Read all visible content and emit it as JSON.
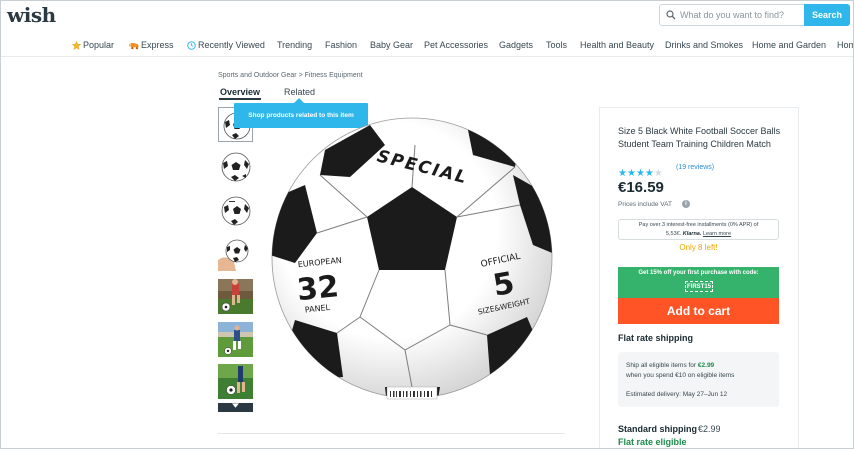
{
  "header": {
    "logo": "wish",
    "search": {
      "placeholder": "What do you want to find?",
      "button": "Search"
    }
  },
  "nav": {
    "items": [
      {
        "label": "Popular",
        "icon": "star-icon"
      },
      {
        "label": "Express",
        "icon": "express-truck-icon"
      },
      {
        "label": "Recently Viewed",
        "icon": "clock-icon"
      },
      {
        "label": "Trending"
      },
      {
        "label": "Fashion"
      },
      {
        "label": "Baby Gear"
      },
      {
        "label": "Pet Accessories"
      },
      {
        "label": "Gadgets"
      },
      {
        "label": "Tools"
      },
      {
        "label": "Health and Beauty"
      },
      {
        "label": "Drinks and Smokes"
      },
      {
        "label": "Home and Garden"
      },
      {
        "label": "Hom"
      }
    ]
  },
  "breadcrumb": {
    "category": "Sports and Outdoor Gear",
    "separator": ">",
    "subcategory": "Fitness Equipment"
  },
  "tabs": {
    "overview": "Overview",
    "related": "Related"
  },
  "tooltip": "Shop products related to this item",
  "product": {
    "title": "Size 5 Black White Football Soccer Balls Student Team Training Children Match",
    "rating": 4,
    "rating_max": 5,
    "reviews": "(19 reviews)",
    "price": "€16.59",
    "vat_note": "Prices include VAT",
    "klarna": {
      "line1": "Pay over 3 interest-free installments (0% APR) of",
      "line2_amount": "5,53€.",
      "brand": "Klarna.",
      "learn_more": "Learn more"
    },
    "stock": "Only 8 left!",
    "promo": {
      "text": "Get 15% off your first purchase with code:",
      "code": "FIRST15"
    },
    "add_to_cart": "Add to cart",
    "ball_print": {
      "top": "SPECIAL",
      "left_top": "EUROPEAN",
      "left_num": "32",
      "left_bottom": "PANEL",
      "right_top": "OFFICIAL",
      "right_num": "5",
      "right_bottom": "SIZE&WEIGHT"
    }
  },
  "shipping": {
    "title": "Flat rate shipping",
    "line1_pre": "Ship all eligible items for ",
    "line1_price": "€2.99",
    "line2": "when you spend €10 on eligible items",
    "delivery": "Estimated delivery: May 27–Jun 12",
    "standard_label": "Standard shipping",
    "standard_price": "€2.99",
    "flat_eligible": "Flat rate eligible"
  },
  "thumbnails": [
    {
      "name": "thumb-ball-1"
    },
    {
      "name": "thumb-ball-2"
    },
    {
      "name": "thumb-ball-3"
    },
    {
      "name": "thumb-ball-hand"
    },
    {
      "name": "thumb-kid-kicking"
    },
    {
      "name": "thumb-player-field"
    },
    {
      "name": "thumb-ball-grass"
    }
  ],
  "colors": {
    "accent_blue": "#2fb7ec",
    "cart_orange": "#ff5526",
    "promo_green": "#35b26b",
    "stock_orange": "#f0a500",
    "star_blue": "#2fb7ec"
  }
}
